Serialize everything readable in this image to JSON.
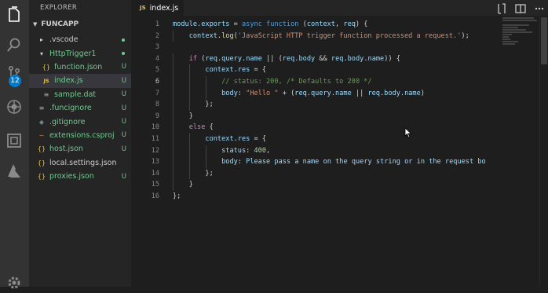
{
  "sidebar": {
    "header": "EXPLORER",
    "section": "FUNCAPP",
    "items": [
      {
        "name": ".vscode",
        "icon": "chevron-right",
        "status": "",
        "dot": true,
        "indent": 1
      },
      {
        "name": "HttpTrigger1",
        "icon": "chevron-down",
        "status": "",
        "dot": true,
        "indent": 1
      },
      {
        "name": "function.json",
        "icon": "json",
        "status": "U",
        "indent": 2
      },
      {
        "name": "index.js",
        "icon": "js",
        "status": "U",
        "indent": 2,
        "selected": true
      },
      {
        "name": "sample.dat",
        "icon": "file",
        "status": "U",
        "indent": 2
      },
      {
        "name": ".funcignore",
        "icon": "file",
        "status": "U",
        "indent": 1
      },
      {
        "name": ".gitignore",
        "icon": "git",
        "status": "U",
        "indent": 1
      },
      {
        "name": "extensions.csproj",
        "icon": "rss",
        "status": "U",
        "indent": 1
      },
      {
        "name": "host.json",
        "icon": "json",
        "status": "U",
        "indent": 1
      },
      {
        "name": "local.settings.json",
        "icon": "json",
        "status": "",
        "indent": 1
      },
      {
        "name": "proxies.json",
        "icon": "json",
        "status": "U",
        "indent": 1
      }
    ]
  },
  "activity": {
    "badge": "12"
  },
  "tab": {
    "icon_text": "JS",
    "label": "index.js"
  },
  "colors": {
    "accent": "#007acc",
    "untracked": "#73c991",
    "js": "#e8c547"
  },
  "editor": {
    "line_numbers": [
      "1",
      "2",
      "3",
      "4",
      "5",
      "6",
      "7",
      "8",
      "9",
      "10",
      "11",
      "12",
      "13",
      "14",
      "15",
      "16"
    ],
    "active_line": 6,
    "lines": [
      "module.exports = async function (context, req) {",
      "    context.log('JavaScript HTTP trigger function processed a request.');",
      "",
      "    if (req.query.name || (req.body && req.body.name)) {",
      "        context.res = {",
      "            // status: 200, /* Defaults to 200 */",
      "            body: \"Hello \" + (req.query.name || req.body.name)",
      "        };",
      "    }",
      "    else {",
      "        context.res = {",
      "            status: 400,",
      "            body: \"Please pass a name on the query string or in the request bo",
      "        };",
      "    }",
      "};"
    ]
  }
}
